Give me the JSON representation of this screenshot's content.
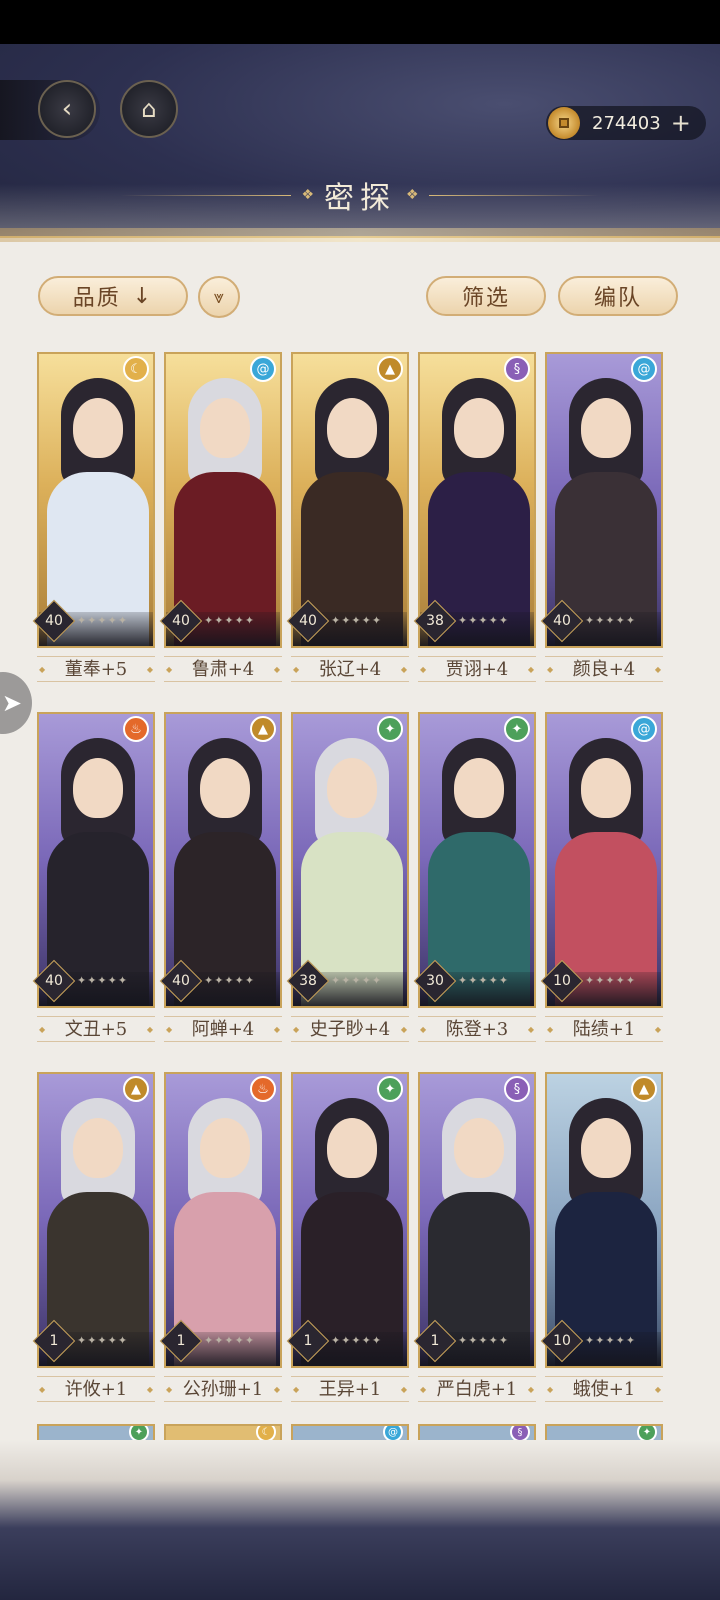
{
  "screen": {
    "title": "密探",
    "currency": {
      "icon": "coin-icon",
      "amount": "274403",
      "add_icon": "plus-icon"
    },
    "nav": {
      "back_icon": "back-arrow-icon",
      "home_icon": "pavilion-icon"
    }
  },
  "toolbar": {
    "sort_label": "品质",
    "sort_arrow": "↓",
    "direction_icon": "⩔",
    "filter_label": "筛选",
    "team_label": "编队"
  },
  "side_tab": {
    "icon": "paper-plane-icon",
    "glyph": "➤"
  },
  "elements": {
    "moon": {
      "glyph": "☾",
      "color": "#e2b04a"
    },
    "wind": {
      "glyph": "@",
      "color": "#3aa7d8"
    },
    "mountain": {
      "glyph": "▲",
      "color": "#c08a2a"
    },
    "cloud": {
      "glyph": "§",
      "color": "#8a5fb6"
    },
    "fire": {
      "glyph": "♨",
      "color": "#e4692a"
    },
    "leaf": {
      "glyph": "✦",
      "color": "#4da05a"
    }
  },
  "cards": [
    {
      "name": "董奉+5",
      "level": "40",
      "element": "moon",
      "frame": "gold",
      "body": "#dfe7f2",
      "hair": "dark"
    },
    {
      "name": "鲁肃+4",
      "level": "40",
      "element": "wind",
      "frame": "gold",
      "body": "#6b1c24",
      "hair": "light"
    },
    {
      "name": "张辽+4",
      "level": "40",
      "element": "mountain",
      "frame": "gold",
      "body": "#3a2a24",
      "hair": "dark"
    },
    {
      "name": "贾诩+4",
      "level": "38",
      "element": "cloud",
      "frame": "gold",
      "body": "#2c1f46",
      "hair": "dark"
    },
    {
      "name": "颜良+4",
      "level": "40",
      "element": "wind",
      "frame": "purple",
      "body": "#3a3036",
      "hair": "dark"
    },
    {
      "name": "文丑+5",
      "level": "40",
      "element": "fire",
      "frame": "purple",
      "body": "#26232c",
      "hair": "dark"
    },
    {
      "name": "阿蝉+4",
      "level": "40",
      "element": "mountain",
      "frame": "purple",
      "body": "#2c2428",
      "hair": "dark"
    },
    {
      "name": "史子眇+4",
      "level": "38",
      "element": "leaf",
      "frame": "purple",
      "body": "#d8e2c4",
      "hair": "light"
    },
    {
      "name": "陈登+3",
      "level": "30",
      "element": "leaf",
      "frame": "purple",
      "body": "#2f6a6a",
      "hair": "dark"
    },
    {
      "name": "陆绩+1",
      "level": "10",
      "element": "wind",
      "frame": "purple",
      "body": "#c25060",
      "hair": "dark"
    },
    {
      "name": "许攸+1",
      "level": "1",
      "element": "mountain",
      "frame": "purple",
      "body": "#3a342e",
      "hair": "light"
    },
    {
      "name": "公孙珊+1",
      "level": "1",
      "element": "fire",
      "frame": "purple",
      "body": "#d8a0ac",
      "hair": "light"
    },
    {
      "name": "王异+1",
      "level": "1",
      "element": "leaf",
      "frame": "purple",
      "body": "#2a2028",
      "hair": "dark"
    },
    {
      "name": "严白虎+1",
      "level": "1",
      "element": "cloud",
      "frame": "purple",
      "body": "#2a2a30",
      "hair": "light"
    },
    {
      "name": "蛾使+1",
      "level": "10",
      "element": "mountain",
      "frame": "blue",
      "body": "#1c2440",
      "hair": "dark"
    }
  ],
  "peek_row": [
    {
      "frame": "blue",
      "element": "leaf"
    },
    {
      "frame": "gold",
      "element": "moon"
    },
    {
      "frame": "blue",
      "element": "wind"
    },
    {
      "frame": "blue",
      "element": "cloud"
    },
    {
      "frame": "blue",
      "element": "leaf"
    }
  ],
  "star_glyphs": "✦✦✦✦✦"
}
